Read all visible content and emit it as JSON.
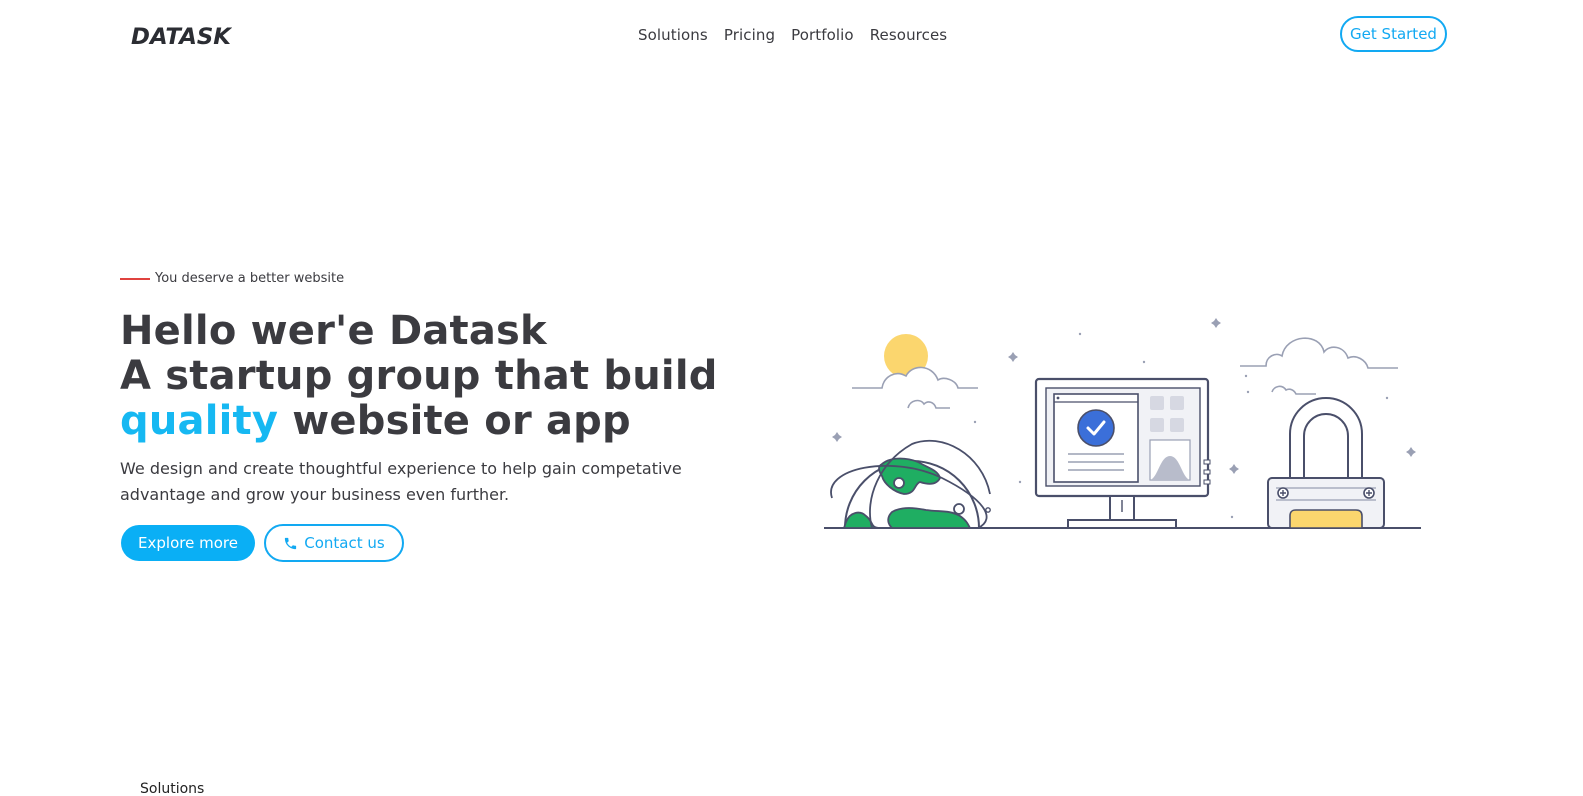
{
  "header": {
    "logo_text": "DATASK",
    "nav": [
      {
        "label": "Solutions"
      },
      {
        "label": "Pricing"
      },
      {
        "label": "Portfolio"
      },
      {
        "label": "Resources"
      }
    ],
    "cta_label": "Get Started"
  },
  "hero": {
    "eyebrow": "You deserve a better website",
    "headline_line1": "Hello wer'e Datask",
    "headline_line2": "A startup group that build",
    "headline_accent": "quality",
    "headline_line3_rest": " website or app",
    "subtext": "We design and create thoughtful experience to help gain competative advantage and grow your business even further.",
    "primary_button": "Explore more",
    "secondary_button": "Contact us",
    "secondary_icon": "phone-icon"
  },
  "footer_peek": {
    "text": "Solutions"
  },
  "colors": {
    "accent": "#12a9f2",
    "accent_text": "#16b8f2",
    "eyebrow_line": "#e0433f",
    "text": "#3b3b40",
    "globe_green": "#1fae62",
    "sun_yellow": "#fbd66e",
    "lock_yellow": "#fbd66e",
    "check_blue": "#3b6fd9"
  }
}
